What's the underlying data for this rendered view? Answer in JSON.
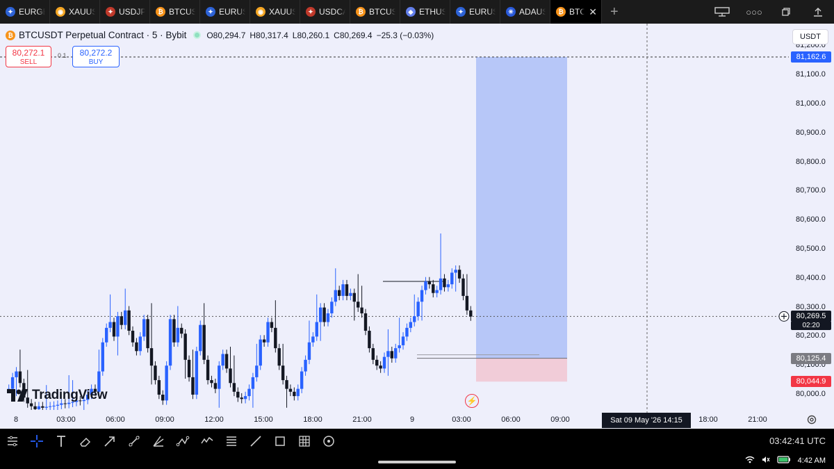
{
  "tabs": [
    {
      "label": "EURGBP",
      "icon": "flag-eu-icon",
      "color": "#2d62d6"
    },
    {
      "label": "XAUUSD",
      "icon": "gold-coin-icon",
      "color": "#f5a623"
    },
    {
      "label": "USDJPY",
      "icon": "flag-us-icon",
      "color": "#c0392b"
    },
    {
      "label": "BTCUSDT",
      "icon": "bitcoin-icon",
      "color": "#f7931a"
    },
    {
      "label": "EURUSD",
      "icon": "flag-eu-icon",
      "color": "#2d62d6"
    },
    {
      "label": "XAUUSD",
      "icon": "gold-coin-icon",
      "color": "#f5a623"
    },
    {
      "label": "USDCAD",
      "icon": "flag-us-icon",
      "color": "#c0392b"
    },
    {
      "label": "BTCUSDT",
      "icon": "bitcoin-icon",
      "color": "#f7931a"
    },
    {
      "label": "ETHUSDT",
      "icon": "ethereum-icon",
      "color": "#627eea"
    },
    {
      "label": "EURUSD",
      "icon": "flag-eu-icon",
      "color": "#2d62d6"
    },
    {
      "label": "ADAUSDT",
      "icon": "cardano-icon",
      "color": "#2a5ada"
    },
    {
      "label": "BTCUSDT",
      "icon": "bitcoin-icon",
      "color": "#f7931a",
      "active": true
    }
  ],
  "symbol": {
    "title": "BTCUSDT Perpetual Contract · 5 · Bybit",
    "ohlc": {
      "o": "O80,294.7",
      "h": "H80,317.4",
      "l": "L80,260.1",
      "c": "C80,269.4",
      "chg": "−25.3 (−0.03%)"
    }
  },
  "trade": {
    "sell_price": "80,272.1",
    "sell_label": "SELL",
    "buy_price": "80,272.2",
    "buy_label": "BUY",
    "spread": "0.1"
  },
  "currency": "USDT",
  "price_axis": {
    "ticks": [
      {
        "value": 81200,
        "label": "81,200.0"
      },
      {
        "value": 81100,
        "label": "81,100.0"
      },
      {
        "value": 81000,
        "label": "81,000.0"
      },
      {
        "value": 80900,
        "label": "80,900.0"
      },
      {
        "value": 80800,
        "label": "80,800.0"
      },
      {
        "value": 80700,
        "label": "80,700.0"
      },
      {
        "value": 80600,
        "label": "80,600.0"
      },
      {
        "value": 80500,
        "label": "80,500.0"
      },
      {
        "value": 80400,
        "label": "80,400.0"
      },
      {
        "value": 80300,
        "label": "80,300.0"
      },
      {
        "value": 80200,
        "label": "80,200.0"
      },
      {
        "value": 80100,
        "label": "80,100.0"
      },
      {
        "value": 80000,
        "label": "80,000.0"
      }
    ],
    "tags": {
      "target": {
        "value": 81162.6,
        "label": "81,162.6",
        "color": "#2962ff"
      },
      "current": {
        "value": 80269.5,
        "label": "80,269.5",
        "countdown": "02:20",
        "color": "#131722"
      },
      "entry": {
        "value": 80125.4,
        "label": "80,125.4",
        "color": "#7b7b82"
      },
      "stop": {
        "value": 80044.9,
        "label": "80,044.9",
        "color": "#f23645"
      }
    }
  },
  "time_axis": {
    "ticks": [
      "8",
      "03:00",
      "06:00",
      "09:00",
      "12:00",
      "15:00",
      "18:00",
      "21:00",
      "9",
      "03:00",
      "06:00",
      "09:00",
      "18:00",
      "21:00"
    ],
    "crosshair_label": "Sat 09 May '26   14:15"
  },
  "chart_data": {
    "type": "candlestick",
    "title": "BTCUSDT Perpetual Contract · 5 · Bybit",
    "ylim": [
      79940,
      81230
    ],
    "close": [
      80020,
      80060,
      80080,
      80040,
      79990,
      79970,
      79960,
      79950,
      79960,
      79955,
      79958,
      79960,
      79962,
      79965,
      79970,
      79968,
      79972,
      79975,
      79980,
      79978,
      79982,
      80000,
      80020,
      80010,
      80080,
      80180,
      80230,
      80250,
      80200,
      80270,
      80240,
      80290,
      80220,
      80180,
      80150,
      80200,
      80260,
      80160,
      80100,
      80050,
      80000,
      79980,
      80100,
      80260,
      80180,
      80230,
      80210,
      80120,
      80060,
      80000,
      80150,
      80240,
      80120,
      80050,
      80040,
      80020,
      80100,
      80140,
      80090,
      80040,
      80010,
      79990,
      79985,
      79995,
      80020,
      80060,
      80100,
      80190,
      80180,
      80250,
      80230,
      80160,
      80100,
      80050,
      80020,
      80010,
      79995,
      80020,
      80080,
      80120,
      80180,
      80200,
      80250,
      80300,
      80250,
      80280,
      80320,
      80360,
      80340,
      80380,
      80340,
      80350,
      80320,
      80300,
      80280,
      80220,
      80160,
      80120,
      80100,
      80090,
      80130,
      80150,
      80125,
      80160,
      80170,
      80200,
      80230,
      80250,
      80270,
      80320,
      80360,
      80390,
      80380,
      80350,
      80360,
      80400,
      80370,
      80380,
      80420,
      80430,
      80400,
      80340,
      80290,
      80269
    ],
    "position": {
      "entry": 80125.4,
      "target": 81162.6,
      "stop": 80044.9
    }
  },
  "drawing_tools": [
    "layout-icon",
    "crosshair-icon",
    "text-icon",
    "eraser-icon",
    "arrow-icon",
    "trendline-icon",
    "gann-icon",
    "path-icon",
    "wave-icon",
    "fib-icon",
    "ruler-icon",
    "rectangle-icon",
    "grid-icon",
    "circle-icon"
  ],
  "clock": "03:42:41 UTC",
  "system": {
    "time": "4:42 AM"
  },
  "brand": "TradingView"
}
